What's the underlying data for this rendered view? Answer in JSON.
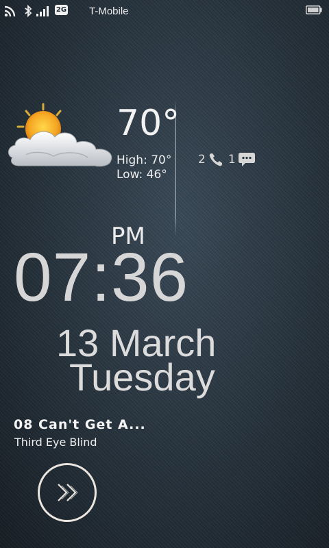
{
  "status_bar": {
    "network_type": "2G",
    "carrier": "T-Mobile",
    "icons": [
      "wifi-icon",
      "bluetooth-icon",
      "signal-icon",
      "battery-icon"
    ]
  },
  "weather": {
    "condition_icon": "partly-cloudy-icon",
    "temperature": "70°",
    "high": "High: 70°",
    "low": "Low: 46°"
  },
  "notifications": {
    "missed_calls": "2",
    "messages": "1"
  },
  "clock": {
    "ampm": "PM",
    "time": "07:36",
    "date": "13 March",
    "day": "Tuesday"
  },
  "music": {
    "track": "08 Can't Get A...",
    "artist": "Third Eye Blind",
    "control_icon": "next-track-icon"
  },
  "colors": {
    "background": "#25313b",
    "text": "#e6e6e6",
    "sun": "#f5a623"
  }
}
